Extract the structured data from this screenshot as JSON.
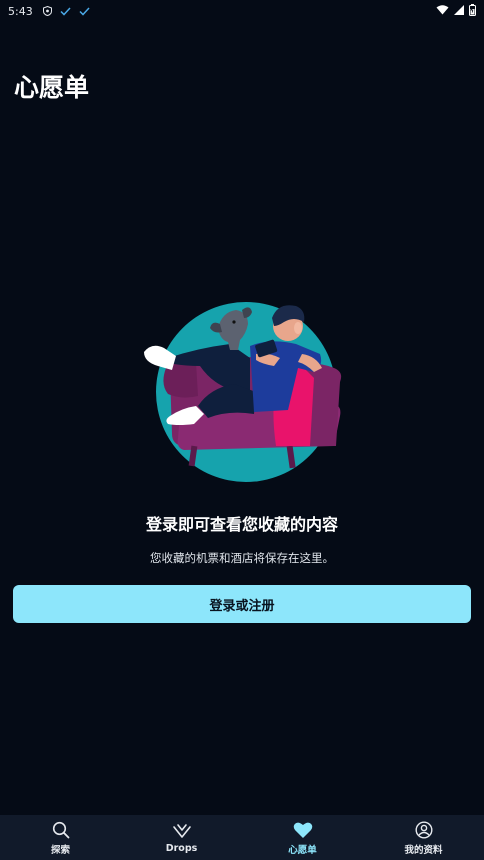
{
  "status_bar": {
    "time": "5:43"
  },
  "header": {
    "title": "心愿单"
  },
  "empty_state": {
    "title": "登录即可查看您收藏的内容",
    "subtitle": "您收藏的机票和酒店将保存在这里。",
    "button_label": "登录或注册"
  },
  "bottom_nav": {
    "items": [
      {
        "label": "探索",
        "icon": "search-icon",
        "active": false
      },
      {
        "label": "Drops",
        "icon": "heart-outline-icon",
        "active": false
      },
      {
        "label": "心愿单",
        "icon": "heart-filled-icon",
        "active": true
      },
      {
        "label": "我的资料",
        "icon": "profile-icon",
        "active": false
      }
    ]
  },
  "colors": {
    "background": "#050b16",
    "accent": "#8de6fb",
    "nav_background": "#111a2a"
  }
}
